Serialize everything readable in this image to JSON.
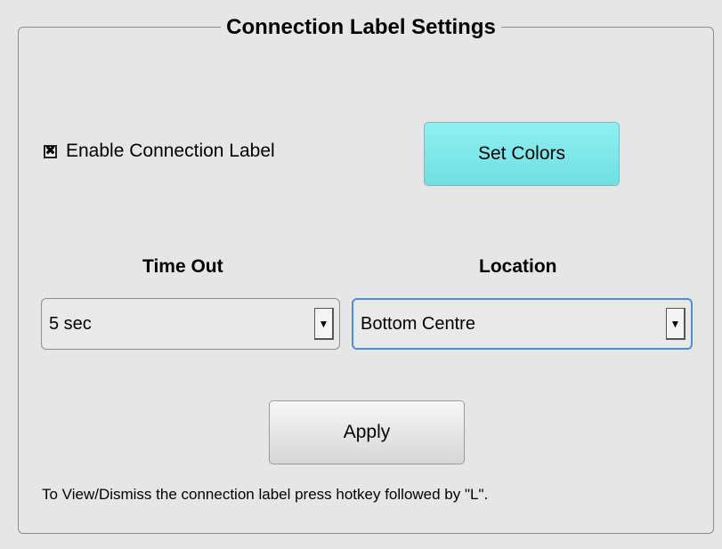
{
  "panel": {
    "title": "Connection Label Settings"
  },
  "enable_label": {
    "checked": true,
    "check_glyph": "✖",
    "label": "Enable Connection Label"
  },
  "set_colors": {
    "label": "Set Colors",
    "color": "#7fe9eb"
  },
  "timeout": {
    "label": "Time Out",
    "value": "5 sec",
    "arrow_icon": "▼"
  },
  "location": {
    "label": "Location",
    "value": "Bottom Centre",
    "arrow_icon": "▼",
    "focus_color": "#4a90d9"
  },
  "apply": {
    "label": "Apply"
  },
  "hint": "To View/Dismiss the connection label press hotkey followed by \"L\"."
}
